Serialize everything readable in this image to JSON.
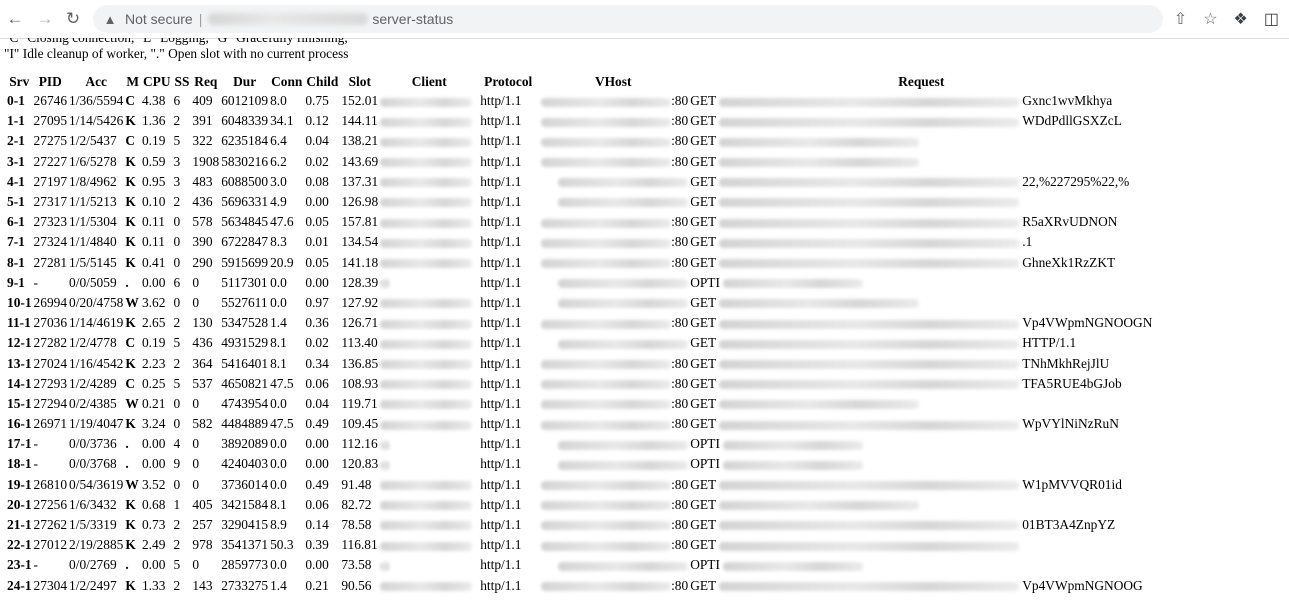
{
  "browser": {
    "security_label": "Not secure",
    "separator": "|",
    "url_path": "server-status"
  },
  "legend": {
    "clipped_line": "\"C\" Closing connection, \"L\" Logging, \"G\" Gracefully finishing,",
    "line": "\"I\" Idle cleanup of worker, \".\" Open slot with no current process"
  },
  "table": {
    "headers": [
      "Srv",
      "PID",
      "Acc",
      "M",
      "CPU",
      "SS",
      "Req",
      "Dur",
      "Conn",
      "Child",
      "Slot",
      "Client",
      "Protocol",
      "VHost",
      "Request"
    ],
    "rows": [
      {
        "srv": "0-1",
        "pid": "26746",
        "acc": "1/36/5594",
        "m": "C",
        "cpu": "4.38",
        "ss": "6",
        "req": "409",
        "dur": "6012109",
        "conn": "8.0",
        "child": "0.75",
        "slot": "152.01",
        "proto": "http/1.1",
        "port": ":80",
        "method": "GET",
        "tail": "Gxnc1wvMkhya",
        "vhost": true,
        "client": true,
        "rq": "long"
      },
      {
        "srv": "1-1",
        "pid": "27095",
        "acc": "1/14/5426",
        "m": "K",
        "cpu": "1.36",
        "ss": "2",
        "req": "391",
        "dur": "6048339",
        "conn": "34.1",
        "child": "0.12",
        "slot": "144.11",
        "proto": "http/1.1",
        "port": ":80",
        "method": "GET",
        "tail": "WDdPdllGSXZcL",
        "vhost": true,
        "client": true,
        "rq": "long"
      },
      {
        "srv": "2-1",
        "pid": "27275",
        "acc": "1/2/5437",
        "m": "C",
        "cpu": "0.19",
        "ss": "5",
        "req": "322",
        "dur": "6235184",
        "conn": "6.4",
        "child": "0.04",
        "slot": "138.21",
        "proto": "http/1.1",
        "port": ":80",
        "method": "GET",
        "tail": "",
        "vhost": true,
        "client": true,
        "rq": "mid"
      },
      {
        "srv": "3-1",
        "pid": "27227",
        "acc": "1/6/5278",
        "m": "K",
        "cpu": "0.59",
        "ss": "3",
        "req": "1908",
        "dur": "5830216",
        "conn": "6.2",
        "child": "0.02",
        "slot": "143.69",
        "proto": "http/1.1",
        "port": ":80",
        "method": "GET",
        "tail": "",
        "vhost": true,
        "client": true,
        "rq": "mid"
      },
      {
        "srv": "4-1",
        "pid": "27197",
        "acc": "1/8/4962",
        "m": "K",
        "cpu": "0.95",
        "ss": "3",
        "req": "483",
        "dur": "6088500",
        "conn": "3.0",
        "child": "0.08",
        "slot": "137.31",
        "proto": "http/1.1",
        "port": "",
        "method": "GET",
        "tail": "22,%227295%22,%",
        "vhost": true,
        "client": true,
        "rq": "long"
      },
      {
        "srv": "5-1",
        "pid": "27317",
        "acc": "1/1/5213",
        "m": "K",
        "cpu": "0.10",
        "ss": "2",
        "req": "436",
        "dur": "5696331",
        "conn": "4.9",
        "child": "0.00",
        "slot": "126.98",
        "proto": "http/1.1",
        "port": "",
        "method": "GET",
        "tail": "",
        "vhost": true,
        "client": true,
        "rq": "long"
      },
      {
        "srv": "6-1",
        "pid": "27323",
        "acc": "1/1/5304",
        "m": "K",
        "cpu": "0.11",
        "ss": "0",
        "req": "578",
        "dur": "5634845",
        "conn": "47.6",
        "child": "0.05",
        "slot": "157.81",
        "proto": "http/1.1",
        "port": ":80",
        "method": "GET",
        "tail": "R5aXRvUDNON",
        "vhost": true,
        "client": true,
        "rq": "long"
      },
      {
        "srv": "7-1",
        "pid": "27324",
        "acc": "1/1/4840",
        "m": "K",
        "cpu": "0.11",
        "ss": "0",
        "req": "390",
        "dur": "6722847",
        "conn": "8.3",
        "child": "0.01",
        "slot": "134.54",
        "proto": "http/1.1",
        "port": ":80",
        "method": "GET",
        "tail": ".1",
        "vhost": true,
        "client": true,
        "rq": "long"
      },
      {
        "srv": "8-1",
        "pid": "27281",
        "acc": "1/5/5145",
        "m": "K",
        "cpu": "0.41",
        "ss": "0",
        "req": "290",
        "dur": "5915699",
        "conn": "20.9",
        "child": "0.05",
        "slot": "141.18",
        "proto": "http/1.1",
        "port": ":80",
        "method": "GET",
        "tail": "GhneXk1RzZKT",
        "vhost": true,
        "client": true,
        "rq": "long"
      },
      {
        "srv": "9-1",
        "pid": "-",
        "acc": "0/0/5059",
        "m": ".",
        "cpu": "0.00",
        "ss": "6",
        "req": "0",
        "dur": "5117301",
        "conn": "0.0",
        "child": "0.00",
        "slot": "128.39",
        "proto": "http/1.1",
        "port": "",
        "method": "OPTI",
        "tail": "",
        "vhost": true,
        "client": false,
        "rq": "small"
      },
      {
        "srv": "10-1",
        "pid": "26994",
        "acc": "0/20/4758",
        "m": "W",
        "cpu": "3.62",
        "ss": "0",
        "req": "0",
        "dur": "5527611",
        "conn": "0.0",
        "child": "0.97",
        "slot": "127.92",
        "proto": "http/1.1",
        "port": "",
        "method": "GET",
        "tail": "",
        "vhost": true,
        "client": true,
        "rq": "mid"
      },
      {
        "srv": "11-1",
        "pid": "27036",
        "acc": "1/14/4619",
        "m": "K",
        "cpu": "2.65",
        "ss": "2",
        "req": "130",
        "dur": "5347528",
        "conn": "1.4",
        "child": "0.36",
        "slot": "126.71",
        "proto": "http/1.1",
        "port": ":80",
        "method": "GET",
        "tail": "Vp4VWpmNGNOOGN",
        "vhost": true,
        "client": true,
        "rq": "long"
      },
      {
        "srv": "12-1",
        "pid": "27282",
        "acc": "1/2/4778",
        "m": "C",
        "cpu": "0.19",
        "ss": "5",
        "req": "436",
        "dur": "4931529",
        "conn": "8.1",
        "child": "0.02",
        "slot": "113.40",
        "proto": "http/1.1",
        "port": "",
        "method": "GET",
        "tail": "HTTP/1.1",
        "vhost": true,
        "client": true,
        "rq": "long"
      },
      {
        "srv": "13-1",
        "pid": "27024",
        "acc": "1/16/4542",
        "m": "K",
        "cpu": "2.23",
        "ss": "2",
        "req": "364",
        "dur": "5416401",
        "conn": "8.1",
        "child": "0.34",
        "slot": "136.85",
        "proto": "http/1.1",
        "port": ":80",
        "method": "GET",
        "tail": "TNhMkhRejJlU",
        "vhost": true,
        "client": true,
        "rq": "long"
      },
      {
        "srv": "14-1",
        "pid": "27293",
        "acc": "1/2/4289",
        "m": "C",
        "cpu": "0.25",
        "ss": "5",
        "req": "537",
        "dur": "4650821",
        "conn": "47.5",
        "child": "0.06",
        "slot": "108.93",
        "proto": "http/1.1",
        "port": ":80",
        "method": "GET",
        "tail": "TFA5RUE4bGJob",
        "vhost": true,
        "client": true,
        "rq": "long"
      },
      {
        "srv": "15-1",
        "pid": "27294",
        "acc": "0/2/4385",
        "m": "W",
        "cpu": "0.21",
        "ss": "0",
        "req": "0",
        "dur": "4743954",
        "conn": "0.0",
        "child": "0.04",
        "slot": "119.71",
        "proto": "http/1.1",
        "port": ":80",
        "method": "GET",
        "tail": "",
        "vhost": true,
        "client": true,
        "rq": "mid"
      },
      {
        "srv": "16-1",
        "pid": "26971",
        "acc": "1/19/4047",
        "m": "K",
        "cpu": "3.24",
        "ss": "0",
        "req": "582",
        "dur": "4484889",
        "conn": "47.5",
        "child": "0.49",
        "slot": "109.45",
        "proto": "http/1.1",
        "port": ":80",
        "method": "GET",
        "tail": "WpVYlNiNzRuN",
        "vhost": true,
        "client": true,
        "rq": "long"
      },
      {
        "srv": "17-1",
        "pid": "-",
        "acc": "0/0/3736",
        "m": ".",
        "cpu": "0.00",
        "ss": "4",
        "req": "0",
        "dur": "3892089",
        "conn": "0.0",
        "child": "0.00",
        "slot": "112.16",
        "proto": "http/1.1",
        "port": "",
        "method": "OPTI",
        "tail": "",
        "vhost": true,
        "client": false,
        "rq": "small"
      },
      {
        "srv": "18-1",
        "pid": "-",
        "acc": "0/0/3768",
        "m": ".",
        "cpu": "0.00",
        "ss": "9",
        "req": "0",
        "dur": "4240403",
        "conn": "0.0",
        "child": "0.00",
        "slot": "120.83",
        "proto": "http/1.1",
        "port": "",
        "method": "OPTI",
        "tail": "",
        "vhost": true,
        "client": false,
        "rq": "small"
      },
      {
        "srv": "19-1",
        "pid": "26810",
        "acc": "0/54/3619",
        "m": "W",
        "cpu": "3.52",
        "ss": "0",
        "req": "0",
        "dur": "3736014",
        "conn": "0.0",
        "child": "0.49",
        "slot": "91.48",
        "proto": "http/1.1",
        "port": ":80",
        "method": "GET",
        "tail": "W1pMVVQR01id",
        "vhost": true,
        "client": true,
        "rq": "long"
      },
      {
        "srv": "20-1",
        "pid": "27256",
        "acc": "1/6/3432",
        "m": "K",
        "cpu": "0.68",
        "ss": "1",
        "req": "405",
        "dur": "3421584",
        "conn": "8.1",
        "child": "0.06",
        "slot": "82.72",
        "proto": "http/1.1",
        "port": ":80",
        "method": "GET",
        "tail": "",
        "vhost": true,
        "client": true,
        "rq": "mid"
      },
      {
        "srv": "21-1",
        "pid": "27262",
        "acc": "1/5/3319",
        "m": "K",
        "cpu": "0.73",
        "ss": "2",
        "req": "257",
        "dur": "3290415",
        "conn": "8.9",
        "child": "0.14",
        "slot": "78.58",
        "proto": "http/1.1",
        "port": ":80",
        "method": "GET",
        "tail": "01BT3A4ZnpYZ",
        "vhost": true,
        "client": true,
        "rq": "long"
      },
      {
        "srv": "22-1",
        "pid": "27012",
        "acc": "2/19/2885",
        "m": "K",
        "cpu": "2.49",
        "ss": "2",
        "req": "978",
        "dur": "3541371",
        "conn": "50.3",
        "child": "0.39",
        "slot": "116.81",
        "proto": "http/1.1",
        "port": ":80",
        "method": "GET",
        "tail": "",
        "vhost": true,
        "client": true,
        "rq": "long"
      },
      {
        "srv": "23-1",
        "pid": "-",
        "acc": "0/0/2769",
        "m": ".",
        "cpu": "0.00",
        "ss": "5",
        "req": "0",
        "dur": "2859773",
        "conn": "0.0",
        "child": "0.00",
        "slot": "73.58",
        "proto": "http/1.1",
        "port": "",
        "method": "OPTI",
        "tail": "",
        "vhost": true,
        "client": false,
        "rq": "small"
      },
      {
        "srv": "24-1",
        "pid": "27304",
        "acc": "1/2/2497",
        "m": "K",
        "cpu": "1.33",
        "ss": "2",
        "req": "143",
        "dur": "2733275",
        "conn": "1.4",
        "child": "0.21",
        "slot": "90.56",
        "proto": "http/1.1",
        "port": ":80",
        "method": "GET",
        "tail": "Vp4VWpmNGNOOG",
        "vhost": true,
        "client": true,
        "rq": "long"
      }
    ]
  }
}
